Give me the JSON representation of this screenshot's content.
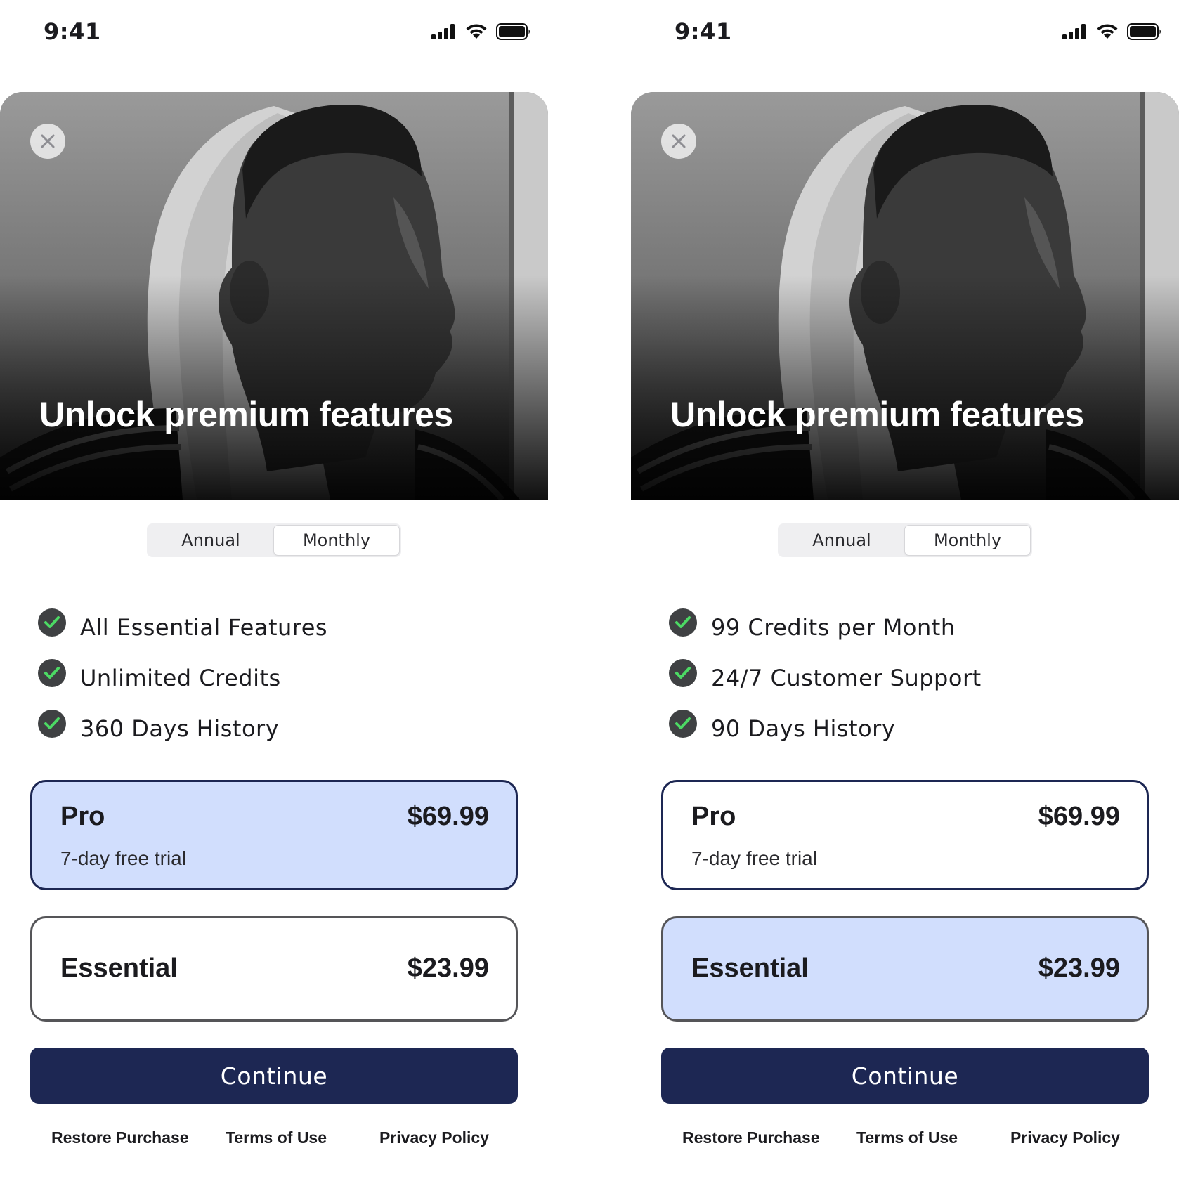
{
  "screens": [
    {
      "status": {
        "time": "9:41"
      },
      "hero": {
        "title": "Unlock premium features"
      },
      "segment": {
        "annual": "Annual",
        "monthly": "Monthly",
        "selected": "Monthly"
      },
      "features": [
        "All Essential Features",
        "Unlimited Credits",
        "360 Days History"
      ],
      "plans": {
        "pro": {
          "name": "Pro",
          "subtitle": "7-day free trial",
          "price": "$69.99",
          "selected": true
        },
        "essential": {
          "name": "Essential",
          "price": "$23.99",
          "selected": false
        }
      },
      "continue_label": "Continue",
      "links": {
        "restore": "Restore Purchase",
        "terms": "Terms of Use",
        "privacy": "Privacy Policy"
      }
    },
    {
      "status": {
        "time": "9:41"
      },
      "hero": {
        "title": "Unlock premium features"
      },
      "segment": {
        "annual": "Annual",
        "monthly": "Monthly",
        "selected": "Monthly"
      },
      "features": [
        "99 Credits per Month",
        "24/7 Customer Support",
        "90 Days History"
      ],
      "plans": {
        "pro": {
          "name": "Pro",
          "subtitle": "7-day free trial",
          "price": "$69.99",
          "selected": false
        },
        "essential": {
          "name": "Essential",
          "price": "$23.99",
          "selected": true
        }
      },
      "continue_label": "Continue",
      "links": {
        "restore": "Restore Purchase",
        "terms": "Terms of Use",
        "privacy": "Privacy Policy"
      }
    }
  ],
  "colors": {
    "primary": "#1d2753",
    "selected_plan_bg": "#d1defd",
    "check_bg": "#3f4143",
    "check_mark": "#4cd964"
  },
  "icons": [
    "signal-icon",
    "wifi-icon",
    "battery-icon",
    "close-icon",
    "check-icon"
  ]
}
